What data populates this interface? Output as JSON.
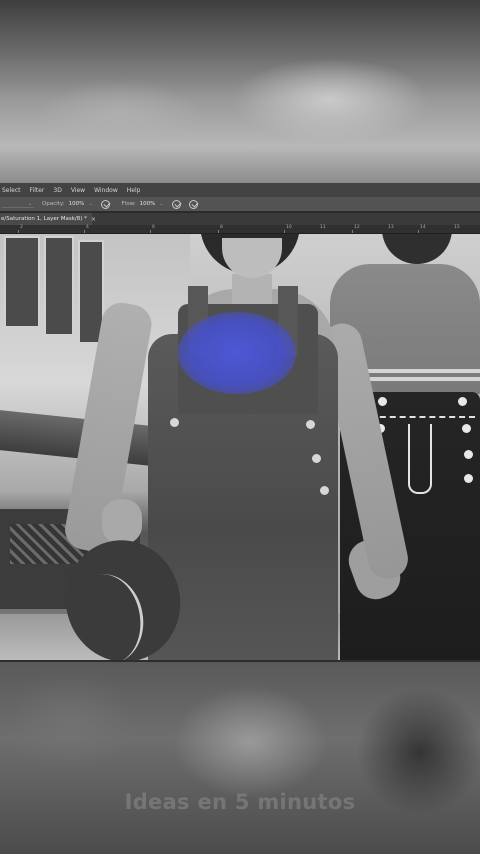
{
  "menu": {
    "items": [
      "Select",
      "Filter",
      "3D",
      "View",
      "Window",
      "Help"
    ]
  },
  "options_bar": {
    "opacity_label": "Opacity:",
    "opacity_value": "100%",
    "flow_label": "Flow:",
    "flow_value": "100%"
  },
  "document_tab": {
    "title": "e/Saturation 1, Layer Mask/8) *",
    "close": "×"
  },
  "ruler": {
    "ticks": [
      "2",
      "4",
      "6",
      "8",
      "10",
      "11",
      "12",
      "13",
      "14",
      "15"
    ]
  },
  "watermark": "Ideas en 5 minutos",
  "colors": {
    "mask_brush": "#4e58dc",
    "menubar": "#434343",
    "optionsbar": "#535353"
  }
}
